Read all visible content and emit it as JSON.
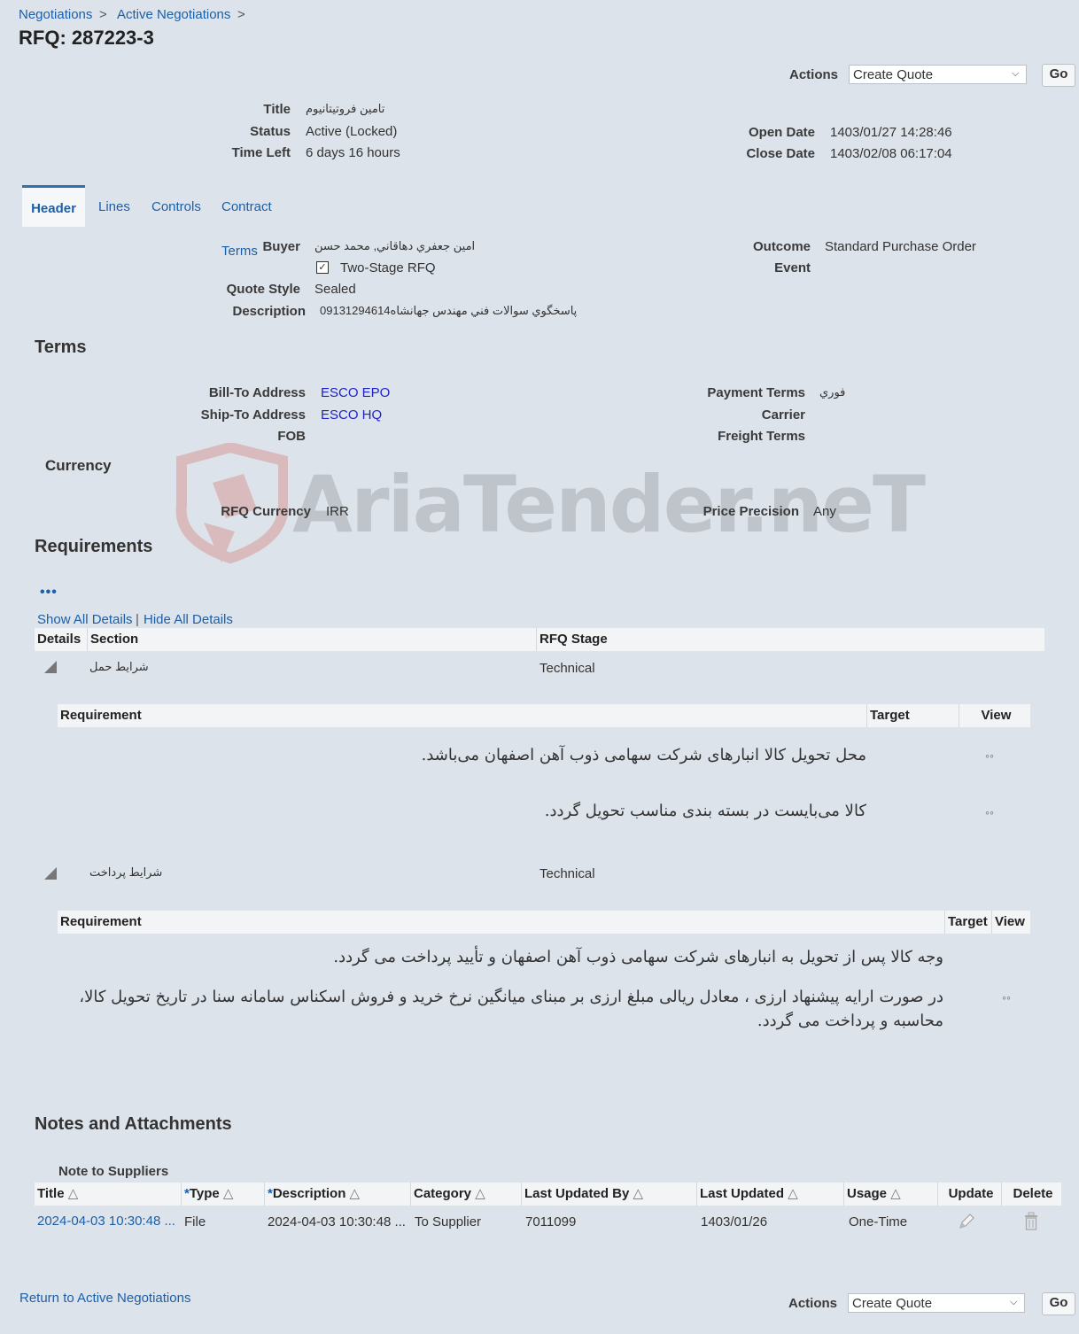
{
  "breadcrumb": {
    "item1": "Negotiations",
    "item2": "Active Negotiations",
    "sep": ">"
  },
  "page_title": "RFQ: 287223-3",
  "actions": {
    "label": "Actions",
    "selected": "Create Quote",
    "go": "Go"
  },
  "summary": {
    "title_label": "Title",
    "title_value": "تامین فروتیتانیوم",
    "status_label": "Status",
    "status_value": "Active (Locked)",
    "time_left_label": "Time Left",
    "time_left_value": "6 days 16 hours",
    "open_date_label": "Open Date",
    "open_date_value": "1403/01/27 14:28:46",
    "close_date_label": "Close Date",
    "close_date_value": "1403/02/08 06:17:04"
  },
  "tabs": [
    "Header",
    "Lines",
    "Controls",
    "Contract Terms"
  ],
  "header": {
    "buyer_label": "Buyer",
    "buyer_value": "امين جعفري دهاقاني, محمد حسن",
    "two_stage_label": "Two-Stage RFQ",
    "quote_style_label": "Quote Style",
    "quote_style_value": "Sealed",
    "description_label": "Description",
    "description_value": "پاسخگوي سوالات فني مهندس جهانشاه09131294614",
    "outcome_label": "Outcome",
    "outcome_value": "Standard Purchase Order",
    "event_label": "Event"
  },
  "terms": {
    "heading": "Terms",
    "bill_to_label": "Bill-To Address",
    "bill_to_value": "ESCO EPO",
    "ship_to_label": "Ship-To Address",
    "ship_to_value": "ESCO HQ",
    "fob_label": "FOB",
    "payment_terms_label": "Payment Terms",
    "payment_terms_value": "فوري",
    "carrier_label": "Carrier",
    "freight_terms_label": "Freight Terms"
  },
  "currency": {
    "heading": "Currency",
    "rfq_currency_label": "RFQ Currency",
    "rfq_currency_value": "IRR",
    "price_precision_label": "Price Precision",
    "price_precision_value": "Any"
  },
  "watermark": "AriaTender.neT",
  "requirements": {
    "heading": "Requirements",
    "more_icon": "•••",
    "show_all": "Show All Details",
    "hide_all": "Hide All Details",
    "divider": "|",
    "columns": [
      "Details",
      "Section",
      "RFQ Stage"
    ],
    "sub_columns": [
      "Requirement",
      "Target",
      "View"
    ],
    "sections": [
      {
        "name": "شرایط حمل",
        "stage": "Technical",
        "items": [
          "محل تحویل کالا انبارهای شرکت سهامی ذوب آهن اصفهان می‌باشد.",
          "کالا می‌بایست در بسته بندی مناسب تحویل گردد."
        ]
      },
      {
        "name": "شرایط پرداخت",
        "stage": "Technical",
        "items": [
          "وجه کالا پس از تحویل به انبارهای شرکت سهامی ذوب آهن اصفهان و تأیید پرداخت می گردد.",
          "در صورت ارایه پیشنهاد ارزی ، معادل ریالی مبلغ ارزی بر مبنای میانگین نرخ خرید و فروش اسکناس سامانه سنا در تاریخ تحویل کالا، محاسبه و پرداخت می گردد."
        ]
      }
    ],
    "view_icon": "glasses-icon"
  },
  "notes": {
    "heading": "Notes and Attachments",
    "note_to_suppliers": "Note to Suppliers",
    "columns": [
      "Title",
      "Type",
      "Description",
      "Category",
      "Last Updated By",
      "Last Updated",
      "Usage",
      "Update",
      "Delete"
    ],
    "row": {
      "title": "2024-04-03 10:30:48 ...",
      "type": "File",
      "description": "2024-04-03 10:30:48 ...",
      "category": "To Supplier",
      "last_updated_by": "7011099",
      "last_updated": "1403/01/26",
      "usage": "One-Time"
    }
  },
  "footer": {
    "return_link": "Return to Active Negotiations"
  },
  "colors": {
    "link": "#1b5fa8",
    "background": "#dde3ea",
    "tab_accent": "#2e6fb0"
  }
}
